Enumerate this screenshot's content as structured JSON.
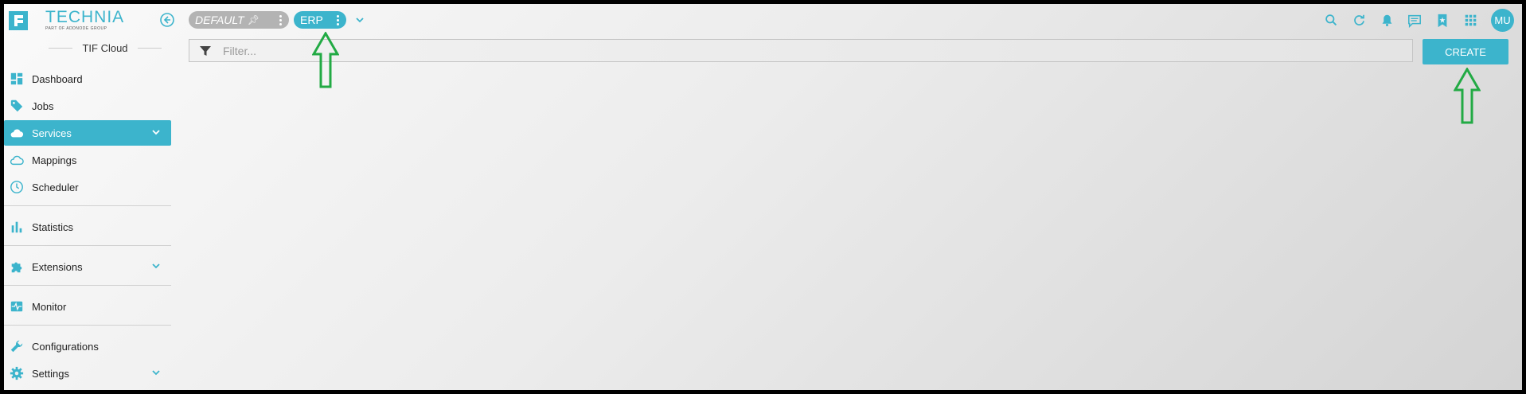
{
  "brand": {
    "name": "TECHNIA",
    "tagline": "PART OF ADDNODE GROUP"
  },
  "sidebar": {
    "section_title": "TIF Cloud",
    "items": [
      {
        "label": "Dashboard",
        "icon": "dashboard-icon"
      },
      {
        "label": "Jobs",
        "icon": "tag-icon"
      },
      {
        "label": "Services",
        "icon": "cloud-icon",
        "active": true,
        "expandable": true
      },
      {
        "label": "Mappings",
        "icon": "cloud-outline-icon"
      },
      {
        "label": "Scheduler",
        "icon": "clock-icon"
      },
      {
        "label": "Statistics",
        "icon": "bar-chart-icon"
      },
      {
        "label": "Extensions",
        "icon": "puzzle-icon",
        "expandable": true
      },
      {
        "label": "Monitor",
        "icon": "monitor-icon"
      },
      {
        "label": "Configurations",
        "icon": "wrench-icon"
      },
      {
        "label": "Settings",
        "icon": "gear-icon",
        "expandable": true
      }
    ]
  },
  "contexts": [
    {
      "label": "DEFAULT",
      "pinned": true
    },
    {
      "label": "ERP",
      "active": true
    }
  ],
  "filter": {
    "placeholder": "Filter..."
  },
  "create_label": "CREATE",
  "user": {
    "initials": "MU"
  },
  "colors": {
    "accent": "#3cb4cc",
    "annotation": "#22aa44"
  }
}
